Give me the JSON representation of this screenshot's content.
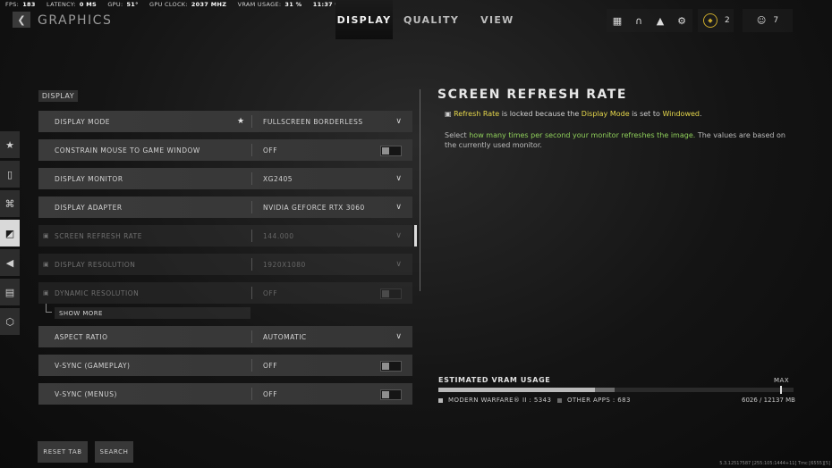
{
  "status": {
    "fps_label": "FPS:",
    "fps": "183",
    "latency_label": "LATENCY:",
    "latency": "0 MS",
    "gpu_label": "GPU:",
    "gpu": "51°",
    "gpu_clock_label": "GPU CLOCK:",
    "gpu_clock": "2037 MHZ",
    "vram_label": "VRAM USAGE:",
    "vram": "31 %",
    "time": "11:37 ᵖµ"
  },
  "header": {
    "back_icon": "chevron-left-icon",
    "title": "GRAPHICS",
    "tabs": [
      {
        "label": "DISPLAY",
        "active": true
      },
      {
        "label": "QUALITY",
        "active": false
      },
      {
        "label": "VIEW",
        "active": false
      }
    ],
    "icons": [
      "grid-icon",
      "headset-icon",
      "bell-icon",
      "gear-icon"
    ],
    "rank_value": "2",
    "friends_count": "7"
  },
  "sidebar": {
    "items": [
      {
        "icon": "star-icon",
        "active": false
      },
      {
        "icon": "mouse-icon",
        "active": false
      },
      {
        "icon": "controller-icon",
        "active": false
      },
      {
        "icon": "display-icon",
        "active": true
      },
      {
        "icon": "speaker-icon",
        "active": false
      },
      {
        "icon": "interface-icon",
        "active": false
      },
      {
        "icon": "network-icon",
        "active": false
      }
    ]
  },
  "settings": {
    "section": "DISPLAY",
    "rows": [
      {
        "label": "DISPLAY MODE",
        "value": "FULLSCREEN BORDERLESS",
        "control": "dropdown",
        "favorite": true
      },
      {
        "label": "CONSTRAIN MOUSE TO GAME WINDOW",
        "value": "OFF",
        "control": "toggle"
      },
      {
        "label": "DISPLAY MONITOR",
        "value": "XG2405",
        "control": "dropdown"
      },
      {
        "label": "DISPLAY ADAPTER",
        "value": "NVIDIA GEFORCE RTX 3060",
        "control": "dropdown"
      },
      {
        "label": "SCREEN REFRESH RATE",
        "value": "144.000",
        "control": "dropdown",
        "locked": true,
        "selected": true
      },
      {
        "label": "DISPLAY RESOLUTION",
        "value": "1920X1080",
        "control": "dropdown",
        "locked": true
      },
      {
        "label": "DYNAMIC RESOLUTION",
        "value": "OFF",
        "control": "toggle",
        "locked": true
      }
    ],
    "show_more": "SHOW MORE",
    "rows2": [
      {
        "label": "ASPECT RATIO",
        "value": "AUTOMATIC",
        "control": "dropdown"
      },
      {
        "label": "V-SYNC (GAMEPLAY)",
        "value": "OFF",
        "control": "toggle"
      },
      {
        "label": "V-SYNC (MENUS)",
        "value": "OFF",
        "control": "toggle"
      }
    ]
  },
  "detail": {
    "title": "SCREEN REFRESH RATE",
    "lock_hl1": "Refresh Rate",
    "lock_t1": " is locked because the ",
    "lock_hl2": "Display Mode",
    "lock_t2": " is set to ",
    "lock_hl3": "Windowed",
    "lock_t3": ".",
    "desc_t1": "Select ",
    "desc_hl": "how many times per second your monitor refreshes the image.",
    "desc_t2": " The values are based on the currently used monitor."
  },
  "vram": {
    "title": "ESTIMATED VRAM USAGE",
    "max_label": "MAX",
    "mw_label": "MODERN WARFARE® II : 5343",
    "other_label": "OTHER APPS : 683",
    "total": "6026 / 12137 MB",
    "mw_mb": 5343,
    "other_mb": 683,
    "total_mb": 12137,
    "mw_color": "#b9b9b9",
    "other_color": "#6a6a6a"
  },
  "footer": {
    "reset_label": "RESET TAB",
    "search_label": "SEARCH",
    "build": "5.3.12517587 [255:105:1444+11] Tmc [6555][5]"
  }
}
